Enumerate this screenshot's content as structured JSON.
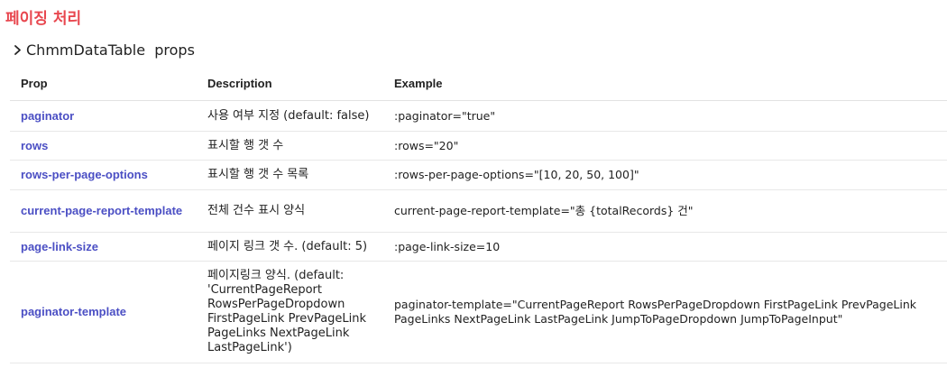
{
  "section": {
    "title": "페이징 처리"
  },
  "props_toggle": {
    "label": "ChmmDataTable  props"
  },
  "table": {
    "headers": [
      "Prop",
      "Description",
      "Example"
    ],
    "rows": [
      {
        "prop": "paginator",
        "description": "사용 여부 지정 (default: false)",
        "example": ":paginator=\"true\""
      },
      {
        "prop": "rows",
        "description": "표시할 행 갯 수",
        "example": ":rows=\"20\""
      },
      {
        "prop": "rows-per-page-options",
        "description": "표시할 행 갯 수 목록",
        "example": ":rows-per-page-options=\"[10, 20, 50, 100]\""
      },
      {
        "prop": "current-page-report-template",
        "description": "전체 건수 표시 양식",
        "example": "current-page-report-template=\"총 {totalRecords} 건\""
      },
      {
        "prop": "page-link-size",
        "description": "페이지 링크 갯 수. (default: 5)",
        "example": ":page-link-size=10"
      },
      {
        "prop": "paginator-template",
        "description": "페이지링크 양식. (default: 'CurrentPageReport RowsPerPageDropdown FirstPageLink PrevPageLink PageLinks NextPageLink LastPageLink')",
        "example": "paginator-template=\"CurrentPageReport RowsPerPageDropdown FirstPageLink PrevPageLink PageLinks NextPageLink LastPageLink JumpToPageDropdown JumpToPageInput\""
      }
    ]
  },
  "colors": {
    "section_title": "#e8474f",
    "prop_name": "#4b4fc4"
  },
  "icons": {
    "toggle": "chevron-right-icon"
  }
}
